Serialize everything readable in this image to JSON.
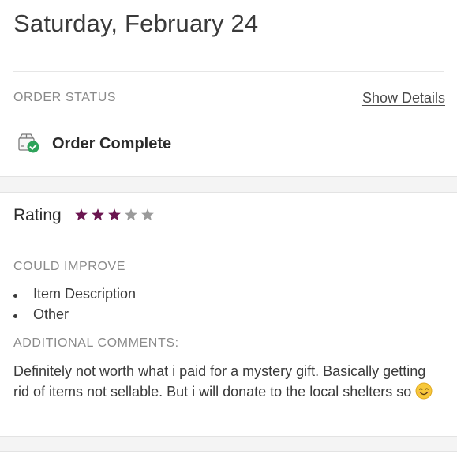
{
  "header": {
    "date": "Saturday, February 24"
  },
  "order_status": {
    "label": "ORDER STATUS",
    "show_details": "Show Details",
    "status": "Order Complete",
    "icon": "package-check-icon"
  },
  "rating": {
    "label": "Rating",
    "value": 3,
    "max": 5,
    "filled_color": "#6b1550",
    "empty_color": "#9b9b9b"
  },
  "improve": {
    "label": "COULD IMPROVE",
    "items": [
      "Item Description",
      "Other"
    ]
  },
  "comments": {
    "label": "ADDITIONAL COMMENTS:",
    "text": "Definitely not worth what i paid for a mystery gift. Basically getting rid of items not sellable. But i will donate to the local shelters so",
    "emoji": "smiling-face-emoji"
  }
}
